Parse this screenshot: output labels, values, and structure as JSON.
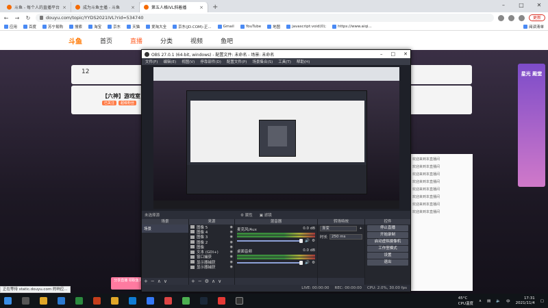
{
  "browser": {
    "tabs": [
      {
        "label": "斗鱼 - 每个人的直播平台",
        "active": false
      },
      {
        "label": "成为斗鱼主播 - 斗鱼",
        "active": false
      },
      {
        "label": "第五人格IVL斜着播",
        "active": true
      }
    ],
    "address": "douyu.com/topic/YYDS2021IVL?rid=534740",
    "update_label": "更新",
    "bookmarks": [
      "应用",
      "百度",
      "苏宁易购",
      "搜索",
      "淘宝",
      "京东",
      "天猫",
      "爱淘大全",
      "京东(JD.COM)-正...",
      "Gmail",
      "YouTube",
      "地图",
      "javascript:void(0);",
      "https://www.aiqi..."
    ],
    "bookmarks_right": "阅读清单",
    "status_url": "正在等待 static.douyu.com 的响应..."
  },
  "site": {
    "logo": "斗鱼",
    "nav": [
      "首页",
      "直播",
      "分类",
      "视频",
      "鱼吧"
    ],
    "anchor_num": "12",
    "room_title": "【六神】游戏室",
    "room_tags": [
      "已关注",
      "超级粉丝"
    ],
    "chat_lines": [
      "欢迎来到本直播间",
      "欢迎来到本直播间",
      "欢迎来到本直播间",
      "欢迎来到本直播间",
      "欢迎来到本直播间",
      "欢迎来到本直播间",
      "欢迎来到本直播间",
      "欢迎来到本直播间"
    ],
    "side_ad_title": "星光 殿堂",
    "pink_btn": "分享直播 领取鱼丸"
  },
  "obs": {
    "title": "OBS 27.0.1 (64-bit, windows) - 配置文件: 未命名 - 场景: 未命名",
    "menu": [
      "文件(F)",
      "编辑(E)",
      "视图(V)",
      "停靠部件(D)",
      "配置文件(P)",
      "场景集合(S)",
      "工具(T)",
      "帮助(H)"
    ],
    "scene_info": "未选择源",
    "props_label": "属性",
    "filters_label": "滤镜",
    "docks": {
      "scenes": "场景",
      "sources": "来源",
      "mixer": "混音器",
      "transitions": "转场特效",
      "controls": "控件"
    },
    "scene_items": [
      "场景"
    ],
    "sources": [
      "图像 5",
      "图像 4",
      "图像 3",
      "图像 2",
      "图像",
      "文本 (GDI+)",
      "窗口捕获",
      "显示器捕获",
      "显示器捕获"
    ],
    "mixer": [
      {
        "name": "麦克风/Aux",
        "db": "0.0 dB"
      },
      {
        "name": "桌面音频",
        "db": "0.0 dB"
      }
    ],
    "transition": {
      "type": "渐变",
      "duration_label": "时长",
      "duration": "250 ms"
    },
    "controls": [
      "停止直播",
      "开始录制",
      "启动虚拟摄像机",
      "工作室模式",
      "设置",
      "退出"
    ],
    "status": {
      "live": "LIVE: 00:00:00",
      "rec": "REC: 00:00:00",
      "cpu": "CPU: 2.0%, 30.00 fps"
    }
  },
  "taskbar": {
    "temp": "45°C",
    "temp_label": "CPU温度",
    "time": "17:31",
    "date": "2021/11/4"
  },
  "colors": {
    "accent": "#ff5d23",
    "obs_bg": "#2b2e38",
    "taskbar": "#101418"
  }
}
